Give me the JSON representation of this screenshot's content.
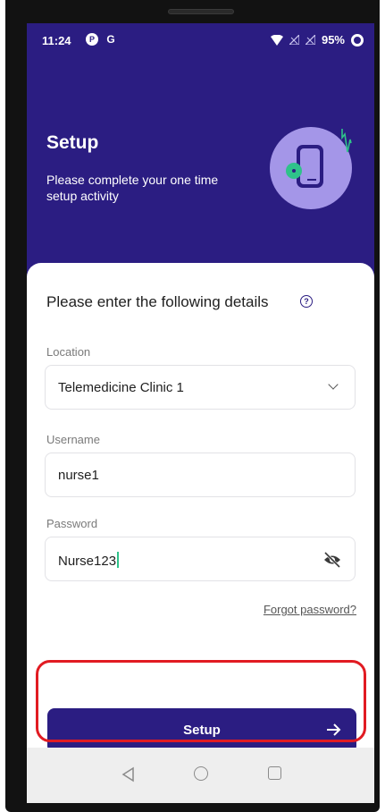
{
  "status_bar": {
    "time": "11:24",
    "icons_left": [
      "pinterest-icon",
      "google-icon"
    ],
    "icons_right": [
      "wifi-icon",
      "signal-off-icon",
      "signal-off-icon",
      "battery-ring-icon"
    ],
    "battery": "95%"
  },
  "header": {
    "title": "Setup",
    "subtitle": "Please complete your one time setup activity",
    "illustration": "phone-settings-icon"
  },
  "form": {
    "title": "Please enter the following details",
    "location": {
      "label": "Location",
      "value": "Telemedicine Clinic 1"
    },
    "username": {
      "label": "Username",
      "value": "nurse1"
    },
    "password": {
      "label": "Password",
      "value": "Nurse123"
    },
    "forgot_password": "Forgot password?"
  },
  "setup_button": {
    "label": "Setup"
  },
  "nav": {
    "icons": [
      "back-icon",
      "home-icon",
      "recents-icon"
    ]
  },
  "colors": {
    "primary": "#2b1d82",
    "accent": "#2fc28a",
    "illustration_bg": "#a496e8",
    "highlight": "#e11b22"
  }
}
